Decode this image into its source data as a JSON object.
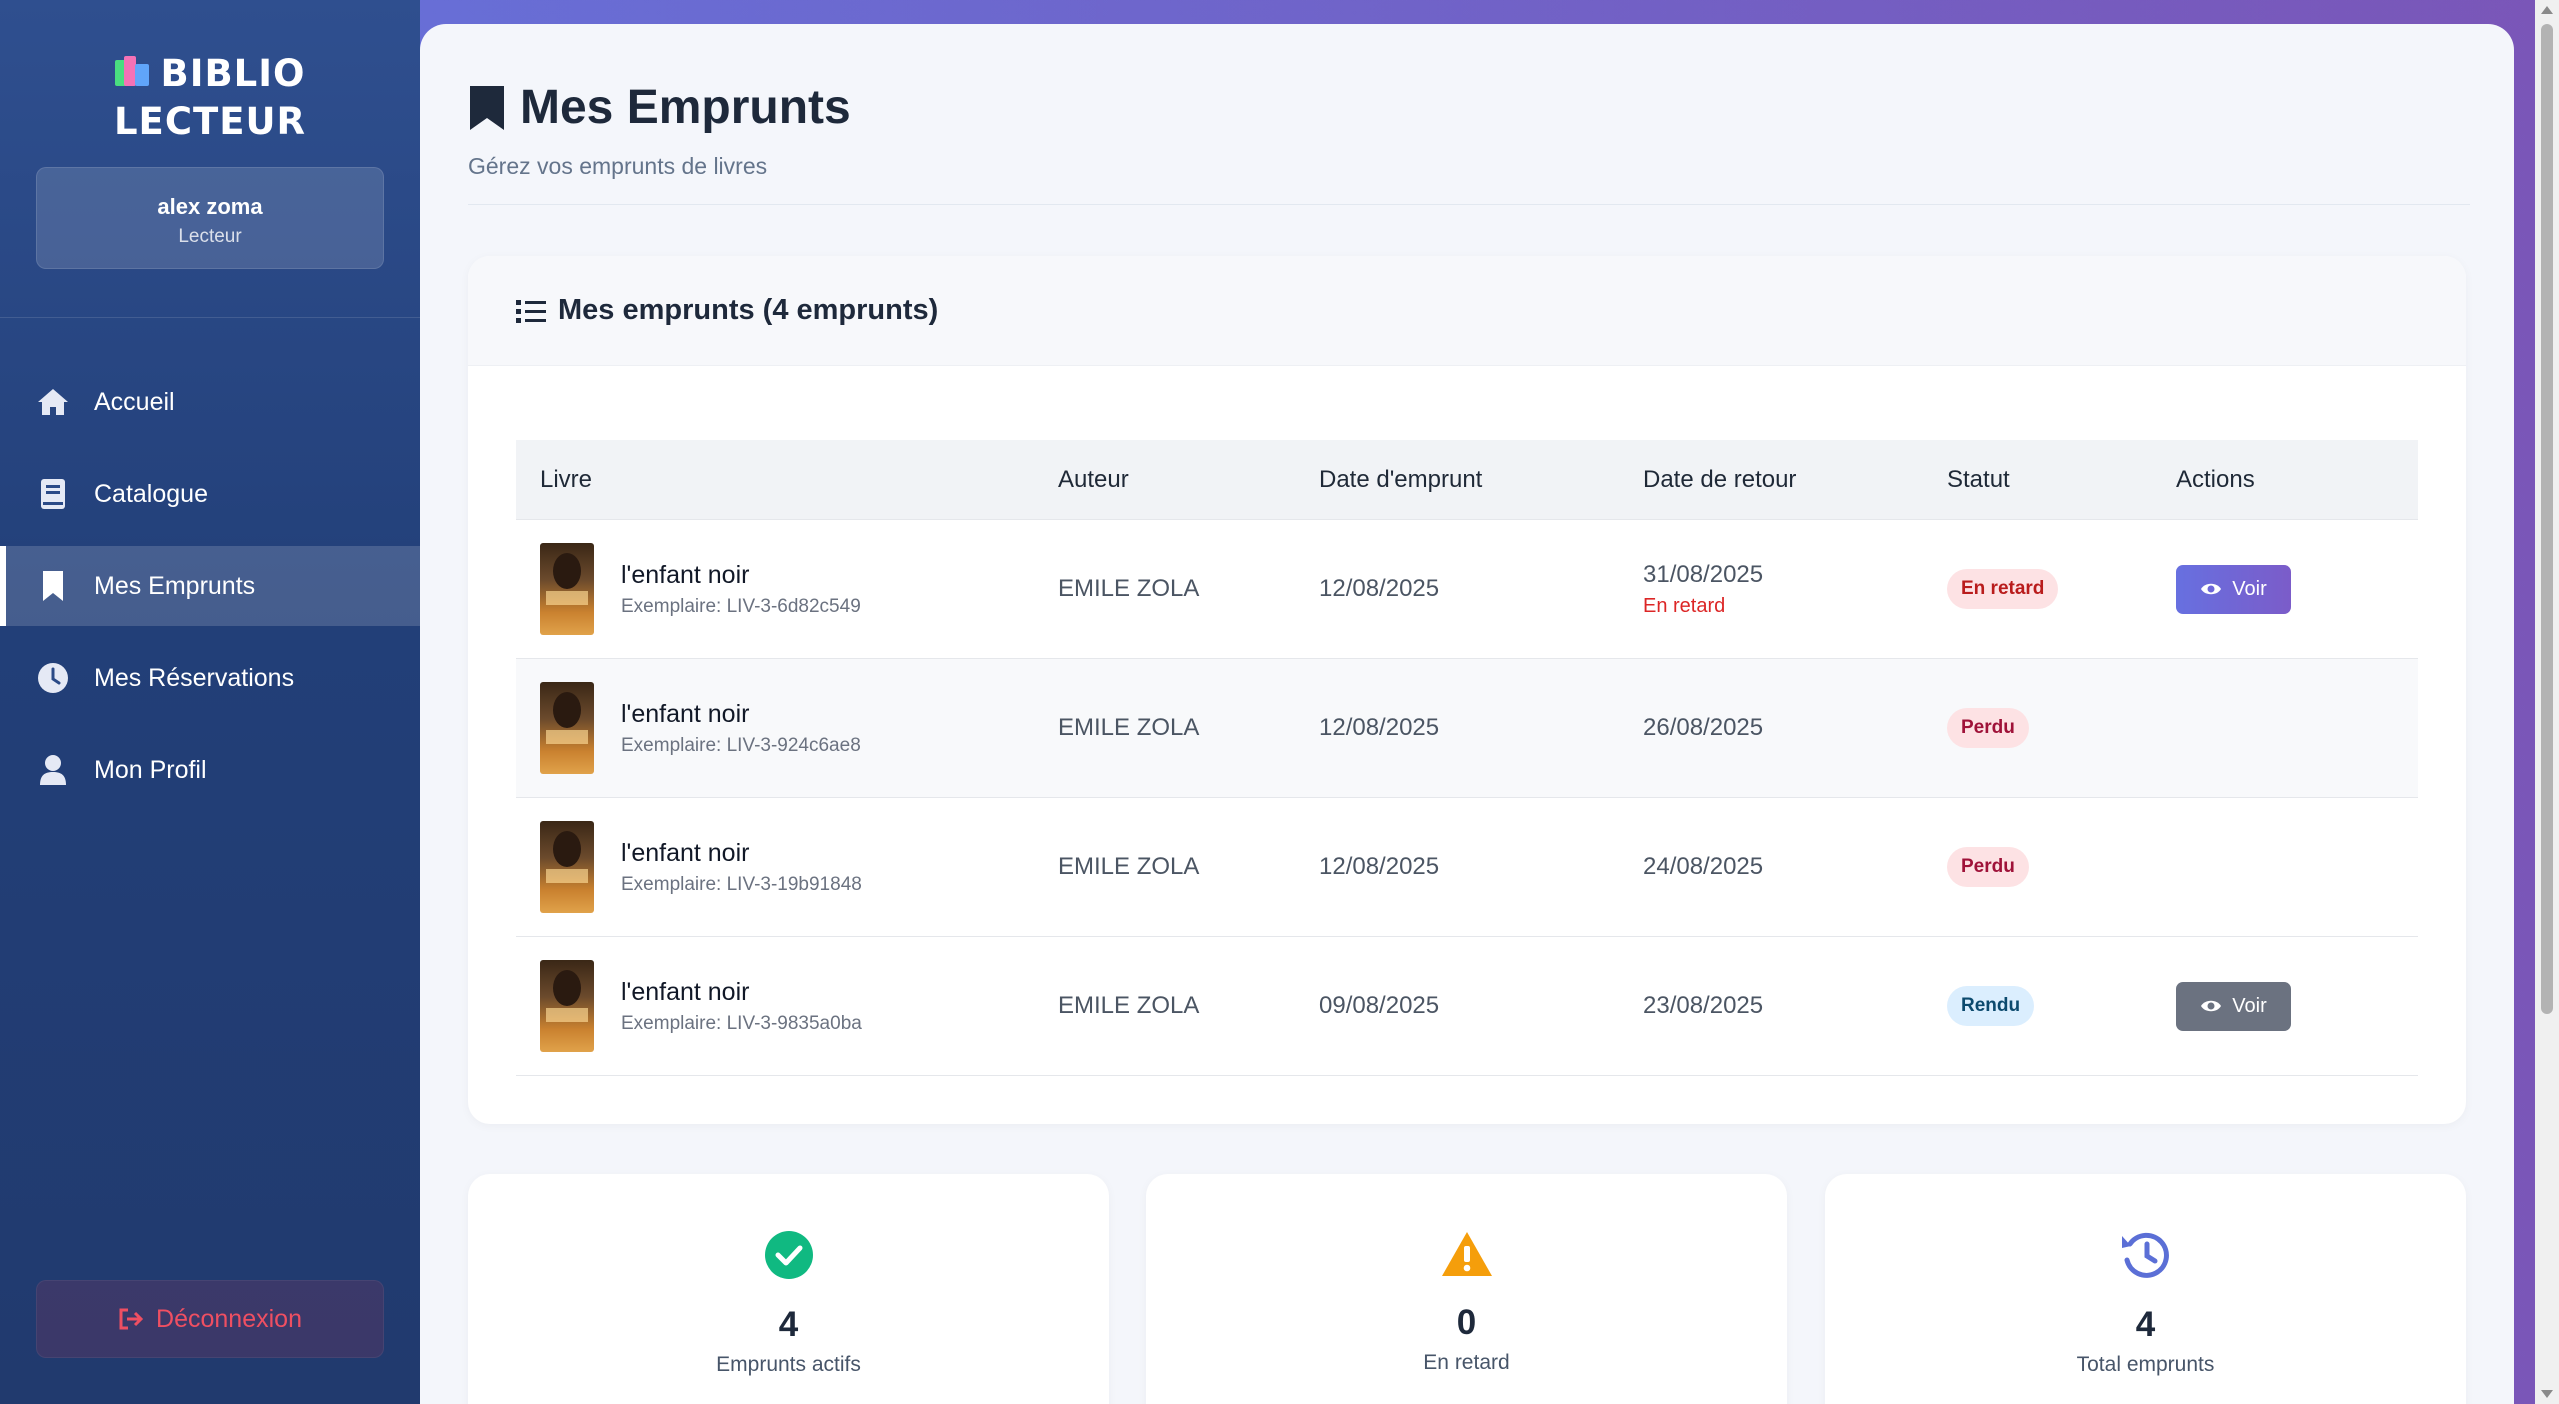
{
  "sidebar": {
    "brand_line1": "BIBLIO",
    "brand_line2": "LECTEUR",
    "user_name": "alex zoma",
    "user_role": "Lecteur",
    "nav": [
      {
        "label": "Accueil",
        "icon": "home-icon"
      },
      {
        "label": "Catalogue",
        "icon": "book-icon"
      },
      {
        "label": "Mes Emprunts",
        "icon": "bookmark-icon",
        "active": true
      },
      {
        "label": "Mes Réservations",
        "icon": "clock-icon"
      },
      {
        "label": "Mon Profil",
        "icon": "user-icon"
      }
    ],
    "logout_label": "Déconnexion"
  },
  "header": {
    "title": "Mes Emprunts",
    "subtitle": "Gérez vos emprunts de livres"
  },
  "loans_card": {
    "title": "Mes emprunts (4 emprunts)",
    "columns": [
      "Livre",
      "Auteur",
      "Date d'emprunt",
      "Date de retour",
      "Statut",
      "Actions"
    ],
    "rows": [
      {
        "title": "l'enfant noir",
        "exemplaire": "Exemplaire: LIV-3-6d82c549",
        "author": "EMILE ZOLA",
        "borrow_date": "12/08/2025",
        "return_date": "31/08/2025",
        "return_note": "En retard",
        "status": "En retard",
        "action": "Voir"
      },
      {
        "title": "l'enfant noir",
        "exemplaire": "Exemplaire: LIV-3-924c6ae8",
        "author": "EMILE ZOLA",
        "borrow_date": "12/08/2025",
        "return_date": "26/08/2025",
        "return_note": "",
        "status": "Perdu",
        "action": ""
      },
      {
        "title": "l'enfant noir",
        "exemplaire": "Exemplaire: LIV-3-19b91848",
        "author": "EMILE ZOLA",
        "borrow_date": "12/08/2025",
        "return_date": "24/08/2025",
        "return_note": "",
        "status": "Perdu",
        "action": ""
      },
      {
        "title": "l'enfant noir",
        "exemplaire": "Exemplaire: LIV-3-9835a0ba",
        "author": "EMILE ZOLA",
        "borrow_date": "09/08/2025",
        "return_date": "23/08/2025",
        "return_note": "",
        "status": "Rendu",
        "action": "Voir"
      }
    ]
  },
  "stats": [
    {
      "value": "4",
      "label": "Emprunts actifs",
      "icon": "check-circle-icon",
      "color": "#10b981"
    },
    {
      "value": "0",
      "label": "En retard",
      "icon": "warning-icon",
      "color": "#f59e0b"
    },
    {
      "value": "4",
      "label": "Total emprunts",
      "icon": "history-icon",
      "color": "#5b6fd6"
    }
  ],
  "colors": {
    "accent": "#6770e0",
    "danger": "#dc2626",
    "sidebar": "#223f78"
  }
}
